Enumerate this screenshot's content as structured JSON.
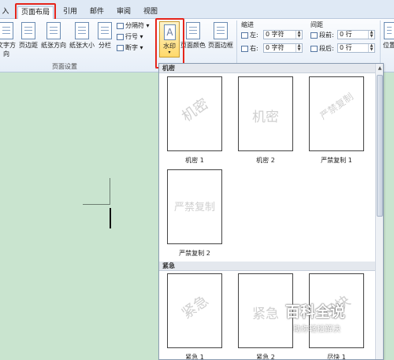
{
  "tabs": [
    {
      "label": "入",
      "active": false
    },
    {
      "label": "页面布局",
      "active": true
    },
    {
      "label": "引用",
      "active": false
    },
    {
      "label": "邮件",
      "active": false
    },
    {
      "label": "审阅",
      "active": false
    },
    {
      "label": "视图",
      "active": false
    }
  ],
  "ribbon": {
    "page_setup": {
      "buttons": [
        "文字方向",
        "页边距",
        "纸张方向",
        "纸张大小",
        "分栏"
      ],
      "small": [
        "分隔符",
        "行号",
        "断字"
      ],
      "group_label": "页面设置"
    },
    "background": {
      "watermark": "水印",
      "page_color": "页面颜色",
      "page_border": "页面边框"
    },
    "indent": {
      "title": "缩进",
      "left_label": "左:",
      "left_value": "0 字符",
      "right_label": "右:",
      "right_value": "0 字符"
    },
    "spacing": {
      "title": "间距",
      "before_label": "段前:",
      "before_value": "0 行",
      "after_label": "段后:",
      "after_value": "0 行"
    },
    "position": "位置"
  },
  "gallery": {
    "sections": [
      {
        "title": "机密",
        "items": [
          {
            "text": "机密",
            "caption": "机密 1",
            "rotated": true
          },
          {
            "text": "机密",
            "caption": "机密 2",
            "rotated": false
          },
          {
            "text": "严禁复制",
            "caption": "严禁复制 1",
            "rotated": true
          },
          {
            "text": "严禁复制",
            "caption": "严禁复制 2",
            "rotated": false
          }
        ]
      },
      {
        "title": "紧急",
        "items": [
          {
            "text": "紧急",
            "caption": "紧急 1",
            "rotated": true
          },
          {
            "text": "紧急",
            "caption": "紧急 2",
            "rotated": false
          },
          {
            "text": "尽快",
            "caption": "尽快 1",
            "rotated": true
          }
        ]
      }
    ]
  },
  "logo": {
    "main": "百科全说",
    "sub": "助你轻松解决"
  }
}
